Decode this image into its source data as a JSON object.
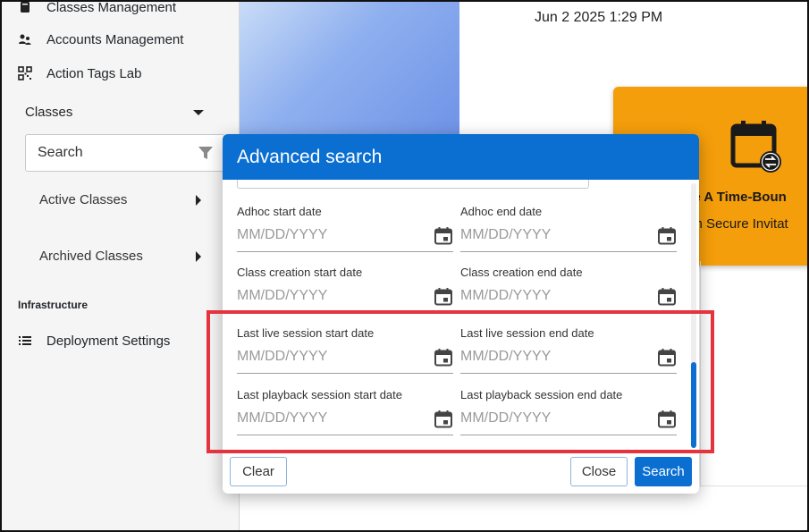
{
  "sidebar": {
    "classes_management": "Classes Management",
    "accounts_management": "Accounts Management",
    "action_tags_lab": "Action Tags Lab",
    "classes_section": "Classes",
    "search_text": "Search",
    "active_classes": "Active Classes",
    "archived_classes": "Archived Classes",
    "infrastructure": "Infrastructure",
    "deployment_settings": "Deployment Settings"
  },
  "main": {
    "datetime": "Jun 2 2025 1:29 PM",
    "card_title": "ule A Time-Boun",
    "card_subtitle": "ch Secure Invitat"
  },
  "modal": {
    "title": "Advanced search",
    "fields": [
      {
        "label": "Adhoc start date",
        "placeholder": "MM/DD/YYYY"
      },
      {
        "label": "Adhoc end date",
        "placeholder": "MM/DD/YYYY"
      },
      {
        "label": "Class creation start date",
        "placeholder": "MM/DD/YYYY"
      },
      {
        "label": "Class creation end date",
        "placeholder": "MM/DD/YYYY"
      },
      {
        "label": "Last live session start date",
        "placeholder": "MM/DD/YYYY"
      },
      {
        "label": "Last live session end date",
        "placeholder": "MM/DD/YYYY"
      },
      {
        "label": "Last playback session start date",
        "placeholder": "MM/DD/YYYY"
      },
      {
        "label": "Last playback session end date",
        "placeholder": "MM/DD/YYYY"
      }
    ],
    "clear_label": "Clear",
    "close_label": "Close",
    "search_label": "Search"
  },
  "colors": {
    "primary": "#0a6fd1",
    "card": "#f59e0b",
    "highlight": "#e5343e"
  },
  "icons": {
    "classes_management": "book-icon",
    "accounts_management": "users-icon",
    "action_tags_lab": "qr-code-icon",
    "deployment_settings": "list-icon",
    "filter": "filter-icon",
    "date": "calendar-icon",
    "card": "calendar-sync-icon"
  }
}
